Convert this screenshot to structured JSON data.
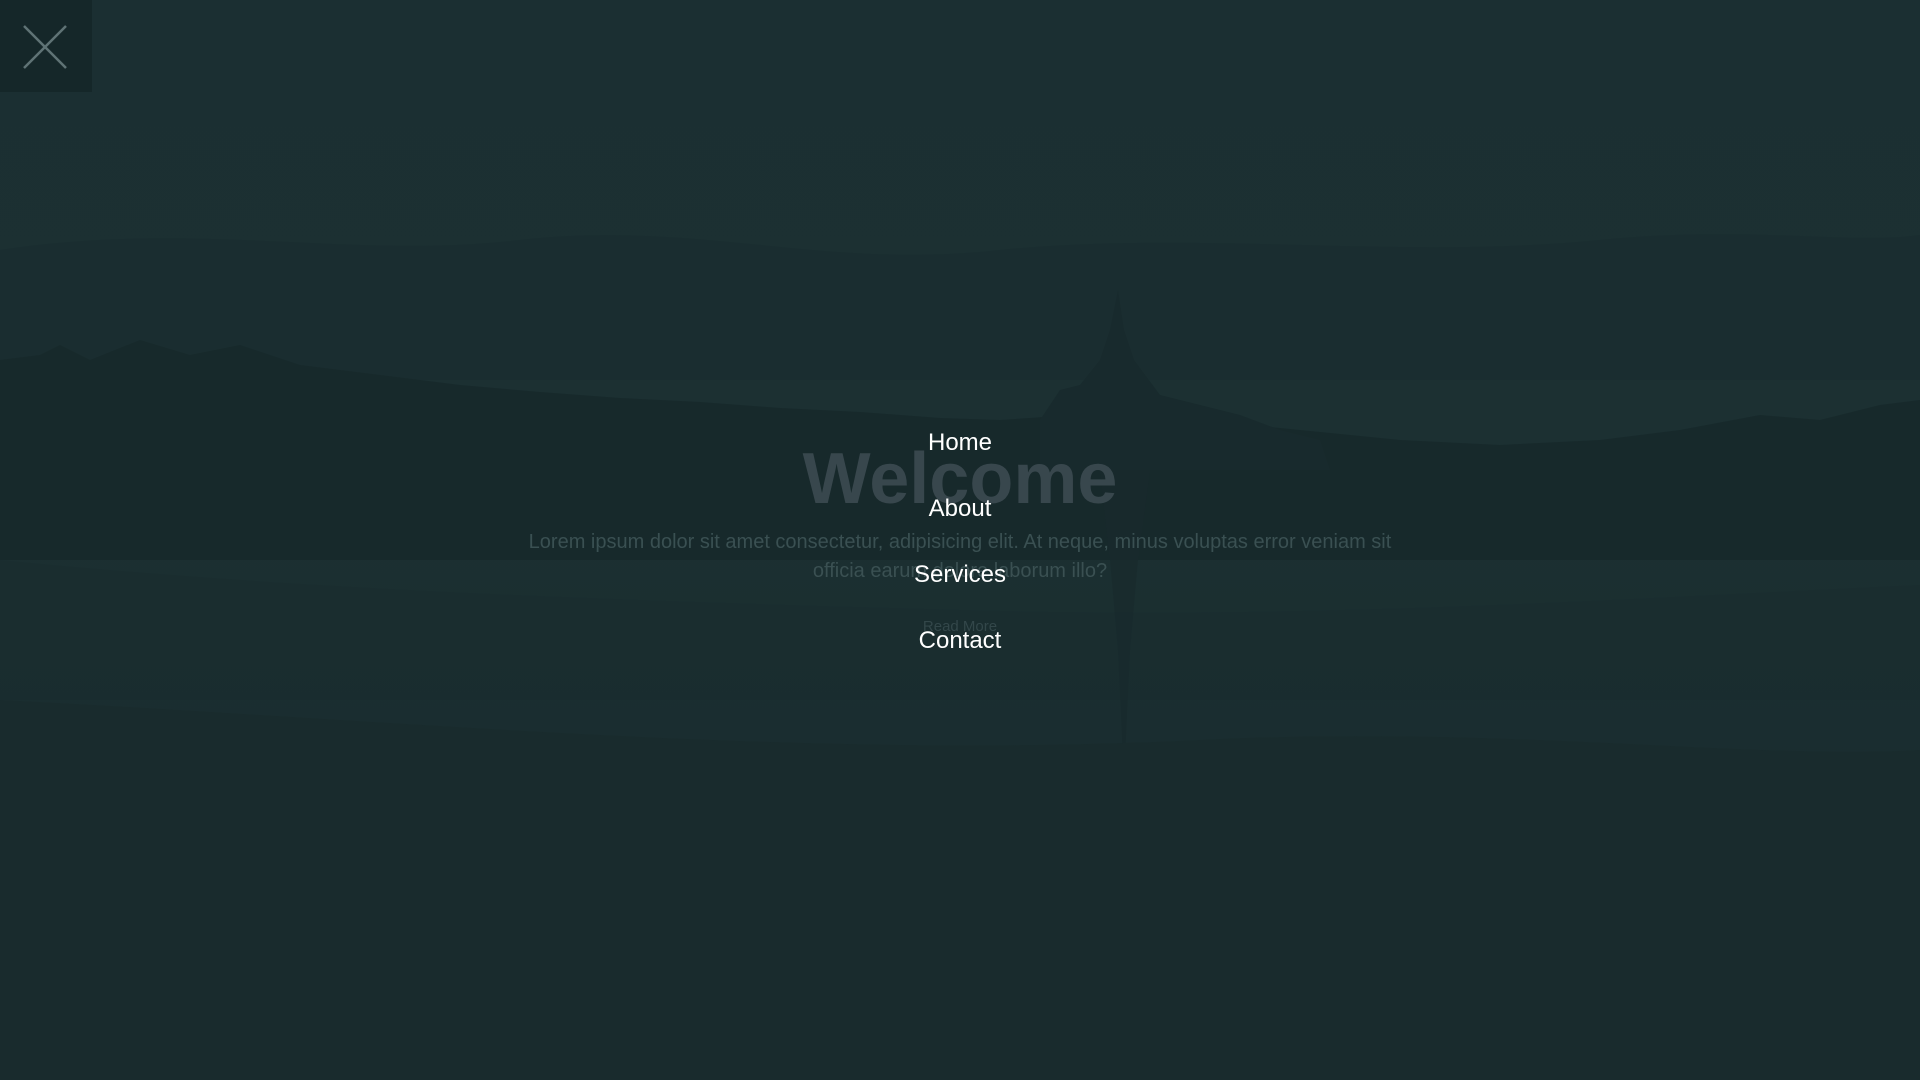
{
  "close": {
    "icon": "close-icon"
  },
  "hero": {
    "title": "Welcome",
    "text": "Lorem ipsum dolor sit amet consectetur, adipisicing elit. At neque, minus voluptas error veniam sit officia earum dolore laborum illo?",
    "cta": "Read More"
  },
  "menu": {
    "items": [
      {
        "label": "Home"
      },
      {
        "label": "About"
      },
      {
        "label": "Services"
      },
      {
        "label": "Contact"
      }
    ]
  },
  "colors": {
    "background": "#1b2c2e",
    "menu_text": "#ffffff",
    "close_icon": "#5f7375"
  }
}
